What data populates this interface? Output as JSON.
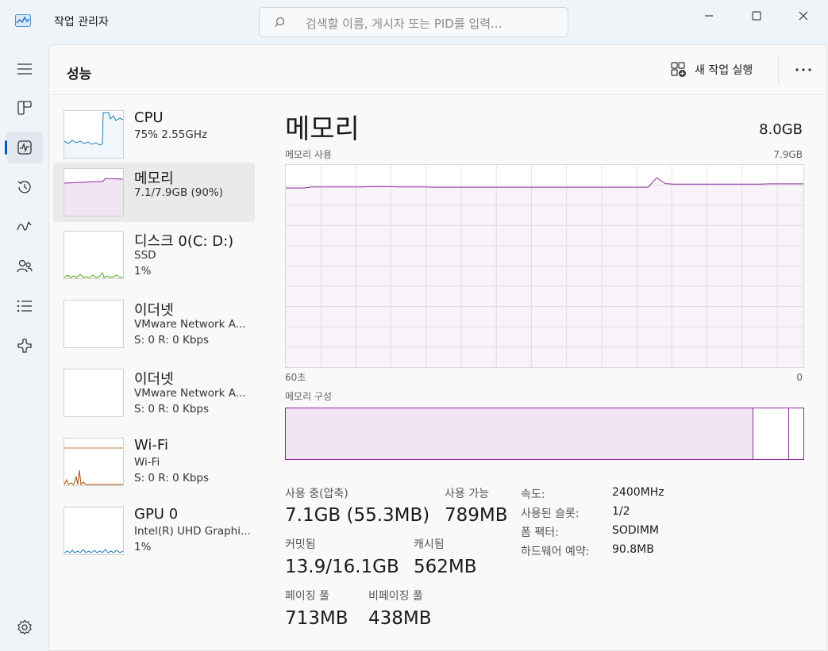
{
  "app": {
    "title": "작업 관리자"
  },
  "search": {
    "placeholder": "검색할 이름, 게시자 또는 PID를 입력..."
  },
  "window_controls": [
    "minimize-icon",
    "maximize-icon",
    "close-icon"
  ],
  "nav": {
    "items": [
      {
        "icon": "hamburger-icon"
      },
      {
        "icon": "processes-icon"
      },
      {
        "icon": "performance-icon",
        "active": true
      },
      {
        "icon": "app-history-icon"
      },
      {
        "icon": "startup-apps-icon"
      },
      {
        "icon": "users-icon"
      },
      {
        "icon": "details-icon"
      },
      {
        "icon": "services-icon"
      },
      {
        "icon": "settings-icon"
      }
    ]
  },
  "header": {
    "title": "성능",
    "new_task": "새 작업 실행"
  },
  "devices": [
    {
      "name": "CPU",
      "line1": "75%  2.55GHz",
      "line2": ""
    },
    {
      "name": "메모리",
      "line1": "7.1/7.9GB (90%)",
      "line2": ""
    },
    {
      "name": "디스크 0(C: D:)",
      "line1": "SSD",
      "line2": "1%"
    },
    {
      "name": "이더넷",
      "line1": "VMware Network A...",
      "line2": "S: 0 R: 0 Kbps"
    },
    {
      "name": "이더넷",
      "line1": "VMware Network A...",
      "line2": "S: 0 R: 0 Kbps"
    },
    {
      "name": "Wi-Fi",
      "line1": "Wi-Fi",
      "line2": "S: 0 R: 0 Kbps"
    },
    {
      "name": "GPU 0",
      "line1": "Intel(R) UHD Graphi...",
      "line2": "1%"
    }
  ],
  "detail": {
    "title": "메모리",
    "capacity": "8.0GB",
    "usage_label": "메모리 사용",
    "usage_max": "7.9GB",
    "x_left": "60초",
    "x_right": "0",
    "composition_label": "메모리 구성",
    "usage_series_gb": [
      7.0,
      7.0,
      7.0,
      7.04,
      7.04,
      7.04,
      7.04,
      7.04,
      7.04,
      7.04,
      7.05,
      7.05,
      7.05,
      7.04,
      7.04,
      7.04,
      7.04,
      7.03,
      7.03,
      7.03,
      7.03,
      7.03,
      7.03,
      7.03,
      7.03,
      7.03,
      7.03,
      7.03,
      7.03,
      7.03,
      7.03,
      7.03,
      7.03,
      7.03,
      7.03,
      7.03,
      7.03,
      7.03,
      7.03,
      7.03,
      7.03,
      7.03,
      7.03,
      7.4,
      7.17,
      7.15,
      7.15,
      7.15,
      7.15,
      7.15,
      7.15,
      7.15,
      7.15,
      7.15,
      7.15,
      7.15,
      7.16,
      7.16,
      7.16,
      7.16,
      7.16
    ],
    "stats": {
      "in_use_label": "사용 중(압축)",
      "in_use_value": "7.1GB (55.3MB)",
      "available_label": "사용 가능",
      "available_value": "789MB",
      "committed_label": "커밋됨",
      "committed_value": "13.9/16.1GB",
      "cached_label": "캐시됨",
      "cached_value": "562MB",
      "paged_label": "페이징 풀",
      "paged_value": "713MB",
      "nonpaged_label": "비페이징 풀",
      "nonpaged_value": "438MB"
    },
    "props": [
      {
        "label": "속도:",
        "value": "2400MHz"
      },
      {
        "label": "사용된 슬롯:",
        "value": "1/2"
      },
      {
        "label": "폼 팩터:",
        "value": "SODIMM"
      },
      {
        "label": "하드웨어 예약:",
        "value": "90.8MB"
      }
    ]
  },
  "colors": {
    "memory": "#8b2c9a",
    "cpu": "#117dbb",
    "disk": "#4da60c",
    "wifi": "#a74f01",
    "accent": "#005fb8"
  }
}
